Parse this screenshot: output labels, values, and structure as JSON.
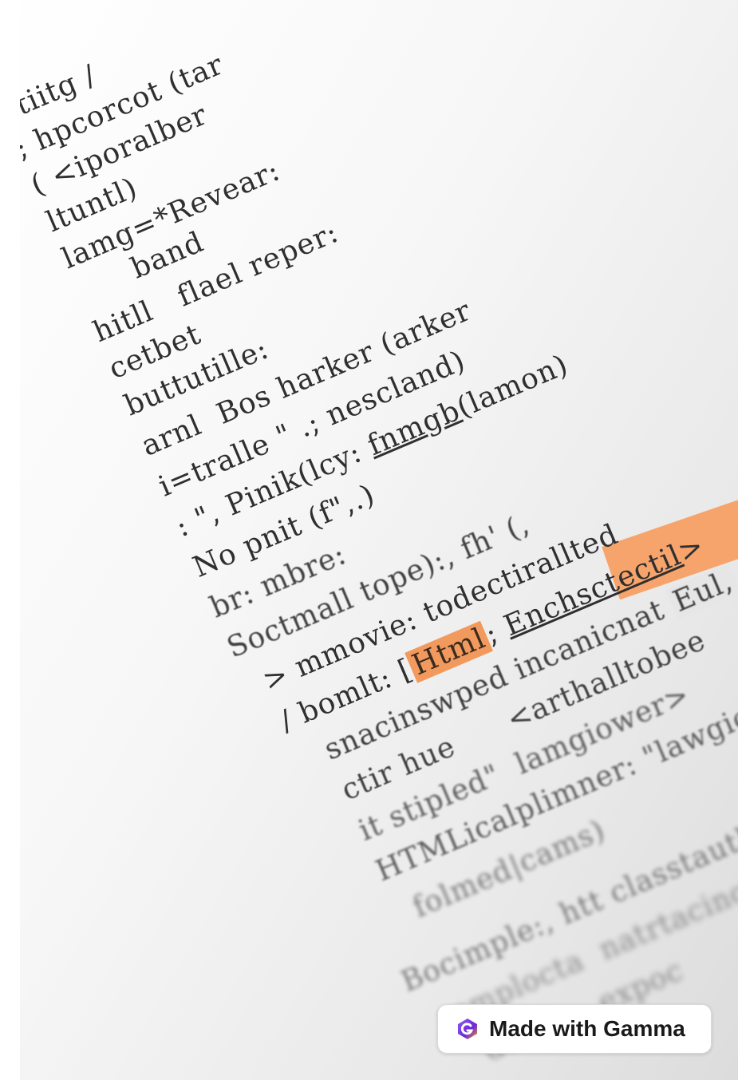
{
  "code_lines": [
    "ctiitg /",
    "; hpcorcot (tar",
    "( <iporalber",
    "ltuntl)",
    "lamg=*Revear:",
    "      band",
    "hitll   flael reper:",
    "cetbet",
    "buttutille:",
    "arnl  Bos harker (arker",
    "i=tralle \" .; nescland)",
    ": \", Pinik(lcy: fnmgb(lamon)",
    "No pnit (f\",.)",
    "br: mbre:",
    "Soctmall tope):, fh' (,",
    "  > mmovie: todectirallted",
    "  / bomlt: [Html; Enchsctectil>",
    "     snacinswped incanicnat Eul,",
    "     ctir hue      <arthalltobee",
    "     it stipled\"  lamgiower>",
    "     HTMLicalplimner: \"lawgiower>",
    "       folmed|cams)",
    "   Bocimple:, htt classtautheet",
    "     remplocta  natrtacinon:",
    "        doc       expoc"
  ],
  "highlighted_token": "Html",
  "underlined_tokens": [
    "fnmgb",
    "Enchsctectil"
  ],
  "badge": {
    "label": "Made with Gamma",
    "icon": "gamma-logo-icon"
  },
  "colors": {
    "highlight": "#f29a5e",
    "text": "#2f2f2f",
    "badge_bg": "#ffffff"
  }
}
